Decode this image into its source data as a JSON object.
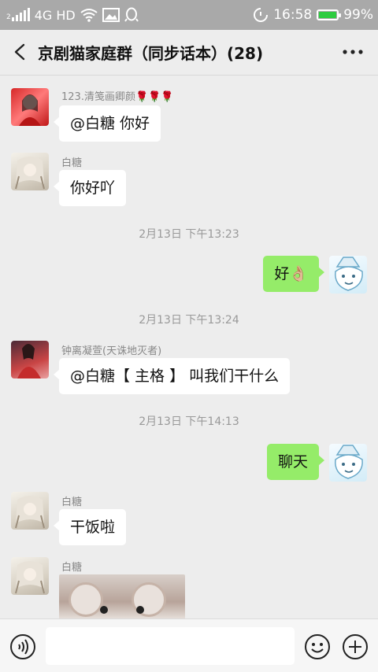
{
  "status_bar": {
    "sim": "2",
    "network": "4G HD",
    "time": "16:58",
    "battery": "99%",
    "battery_level": 0.99,
    "icons": [
      "signal-icon",
      "wifi-icon",
      "image-icon",
      "qq-icon",
      "alarm-icon",
      "battery-icon"
    ]
  },
  "header": {
    "title": "京剧猫家庭群（同步话本）(28)",
    "back_icon": "chevron-left-icon",
    "more_icon": "more-dots-icon"
  },
  "messages": [
    {
      "side": "left",
      "sender": "123.清笺画卿颜🌹🌹🌹",
      "text": "@白糖  你好",
      "avatar": "girl-red-avatar"
    },
    {
      "side": "left",
      "sender": "白糖",
      "text": "你好吖",
      "avatar": "sugar-avatar"
    },
    {
      "time": "2月13日 下午13:23"
    },
    {
      "side": "right",
      "text": "好👌🏼",
      "avatar": "cat-avatar"
    },
    {
      "time": "2月13日 下午13:24"
    },
    {
      "side": "left",
      "sender": "钟离凝萱(天诛地灭者)",
      "text": "@白糖【 主格 】 叫我们干什么",
      "avatar": "fairy-avatar"
    },
    {
      "time": "2月13日 下午14:13"
    },
    {
      "side": "right",
      "text": "聊天",
      "avatar": "cat-avatar"
    },
    {
      "side": "left",
      "sender": "白糖",
      "text": "干饭啦",
      "avatar": "sugar-avatar"
    },
    {
      "side": "left",
      "sender": "白糖",
      "image": "hamster-photo",
      "avatar": "sugar-avatar"
    }
  ],
  "input_bar": {
    "placeholder": "",
    "icons": [
      "voice-icon",
      "emoji-icon",
      "plus-icon"
    ]
  },
  "colors": {
    "status_bar": "#a9a9a9",
    "background": "#ededed",
    "own_bubble": "#95ec69",
    "other_bubble": "#ffffff",
    "battery": "#2ecc40"
  }
}
